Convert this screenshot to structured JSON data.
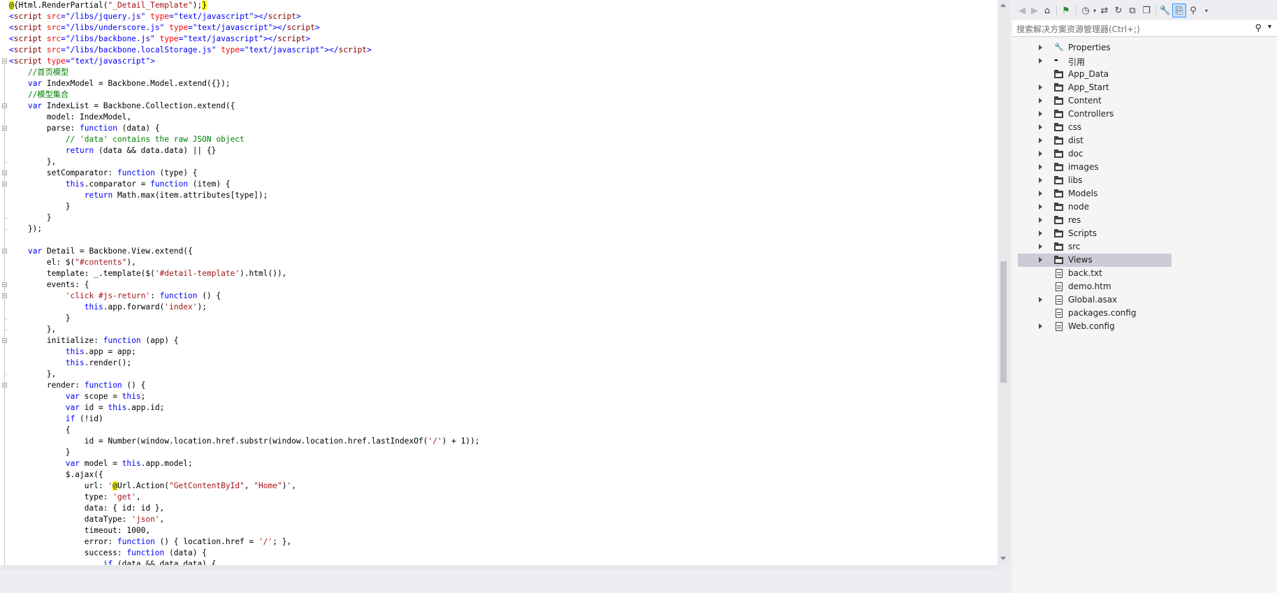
{
  "editor": {
    "lines": [
      [
        [
          "@",
          "r"
        ],
        [
          "{Html.RenderPartial(",
          ""
        ],
        [
          "\"_Detail_Template\"",
          "s"
        ],
        [
          ");",
          ""
        ],
        [
          "}",
          "r"
        ]
      ],
      [
        [
          "<",
          "k"
        ],
        [
          "script",
          "t"
        ],
        [
          " ",
          ""
        ],
        [
          "src",
          "a"
        ],
        [
          "=",
          "k"
        ],
        [
          "\"/libs/jquery.js\"",
          "k"
        ],
        [
          " ",
          ""
        ],
        [
          "type",
          "a"
        ],
        [
          "=",
          "k"
        ],
        [
          "\"text/javascript\"",
          "k"
        ],
        [
          "></",
          "k"
        ],
        [
          "script",
          "t"
        ],
        [
          ">",
          "k"
        ]
      ],
      [
        [
          "<",
          "k"
        ],
        [
          "script",
          "t"
        ],
        [
          " ",
          ""
        ],
        [
          "src",
          "a"
        ],
        [
          "=",
          "k"
        ],
        [
          "\"/libs/underscore.js\"",
          "k"
        ],
        [
          " ",
          ""
        ],
        [
          "type",
          "a"
        ],
        [
          "=",
          "k"
        ],
        [
          "\"text/javascript\"",
          "k"
        ],
        [
          "></",
          "k"
        ],
        [
          "script",
          "t"
        ],
        [
          ">",
          "k"
        ]
      ],
      [
        [
          "<",
          "k"
        ],
        [
          "script",
          "t"
        ],
        [
          " ",
          ""
        ],
        [
          "src",
          "a"
        ],
        [
          "=",
          "k"
        ],
        [
          "\"/libs/backbone.js\"",
          "k"
        ],
        [
          " ",
          ""
        ],
        [
          "type",
          "a"
        ],
        [
          "=",
          "k"
        ],
        [
          "\"text/javascript\"",
          "k"
        ],
        [
          "></",
          "k"
        ],
        [
          "script",
          "t"
        ],
        [
          ">",
          "k"
        ]
      ],
      [
        [
          "<",
          "k"
        ],
        [
          "script",
          "t"
        ],
        [
          " ",
          ""
        ],
        [
          "src",
          "a"
        ],
        [
          "=",
          "k"
        ],
        [
          "\"/libs/backbone.localStorage.js\"",
          "k"
        ],
        [
          " ",
          ""
        ],
        [
          "type",
          "a"
        ],
        [
          "=",
          "k"
        ],
        [
          "\"text/javascript\"",
          "k"
        ],
        [
          "></",
          "k"
        ],
        [
          "script",
          "t"
        ],
        [
          ">",
          "k"
        ]
      ],
      [
        [
          "<",
          "k"
        ],
        [
          "script",
          "t"
        ],
        [
          " ",
          ""
        ],
        [
          "type",
          "a"
        ],
        [
          "=",
          "k"
        ],
        [
          "\"text/javascript\"",
          "k"
        ],
        [
          ">",
          "k"
        ]
      ],
      [
        [
          "    //首页模型",
          "c"
        ]
      ],
      [
        [
          "    ",
          ""
        ],
        [
          "var",
          "k"
        ],
        [
          " IndexModel = Backbone.Model.extend({});",
          ""
        ]
      ],
      [
        [
          "    //模型集合",
          "c"
        ]
      ],
      [
        [
          "    ",
          ""
        ],
        [
          "var",
          "k"
        ],
        [
          " IndexList = Backbone.Collection.extend({",
          ""
        ]
      ],
      [
        [
          "        model: IndexModel,",
          ""
        ]
      ],
      [
        [
          "        parse: ",
          ""
        ],
        [
          "function",
          "k"
        ],
        [
          " (data) {",
          ""
        ]
      ],
      [
        [
          "            // 'data' contains the raw JSON object",
          "c"
        ]
      ],
      [
        [
          "            ",
          ""
        ],
        [
          "return",
          "k"
        ],
        [
          " (data && data.data) || {}",
          ""
        ]
      ],
      [
        [
          "        },",
          ""
        ]
      ],
      [
        [
          "        setComparator: ",
          ""
        ],
        [
          "function",
          "k"
        ],
        [
          " (type) {",
          ""
        ]
      ],
      [
        [
          "            ",
          ""
        ],
        [
          "this",
          "k"
        ],
        [
          ".comparator = ",
          ""
        ],
        [
          "function",
          "k"
        ],
        [
          " (item) {",
          ""
        ]
      ],
      [
        [
          "                ",
          ""
        ],
        [
          "return",
          "k"
        ],
        [
          " Math.max(item.attributes[type]);",
          ""
        ]
      ],
      [
        [
          "            }",
          ""
        ]
      ],
      [
        [
          "        }",
          ""
        ]
      ],
      [
        [
          "    });",
          ""
        ]
      ],
      [
        [
          "",
          ""
        ]
      ],
      [
        [
          "    ",
          ""
        ],
        [
          "var",
          "k"
        ],
        [
          " Detail = Backbone.View.extend({",
          ""
        ]
      ],
      [
        [
          "        el: $(",
          ""
        ],
        [
          "\"#contents\"",
          "s"
        ],
        [
          "),",
          ""
        ]
      ],
      [
        [
          "        template: _.template($(",
          ""
        ],
        [
          "'#detail-template'",
          "s"
        ],
        [
          ").html()),",
          ""
        ]
      ],
      [
        [
          "        events: {",
          ""
        ]
      ],
      [
        [
          "            ",
          ""
        ],
        [
          "'click #js-return'",
          "s"
        ],
        [
          ": ",
          ""
        ],
        [
          "function",
          "k"
        ],
        [
          " () {",
          ""
        ]
      ],
      [
        [
          "                ",
          ""
        ],
        [
          "this",
          "k"
        ],
        [
          ".app.forward(",
          ""
        ],
        [
          "'index'",
          "s"
        ],
        [
          ");",
          ""
        ]
      ],
      [
        [
          "            }",
          ""
        ]
      ],
      [
        [
          "        },",
          ""
        ]
      ],
      [
        [
          "        initialize: ",
          ""
        ],
        [
          "function",
          "k"
        ],
        [
          " (app) {",
          ""
        ]
      ],
      [
        [
          "            ",
          ""
        ],
        [
          "this",
          "k"
        ],
        [
          ".app = app;",
          ""
        ]
      ],
      [
        [
          "            ",
          ""
        ],
        [
          "this",
          "k"
        ],
        [
          ".render();",
          ""
        ]
      ],
      [
        [
          "        },",
          ""
        ]
      ],
      [
        [
          "        render: ",
          ""
        ],
        [
          "function",
          "k"
        ],
        [
          " () {",
          ""
        ]
      ],
      [
        [
          "            ",
          ""
        ],
        [
          "var",
          "k"
        ],
        [
          " scope = ",
          ""
        ],
        [
          "this",
          "k"
        ],
        [
          ";",
          ""
        ]
      ],
      [
        [
          "            ",
          ""
        ],
        [
          "var",
          "k"
        ],
        [
          " id = ",
          ""
        ],
        [
          "this",
          "k"
        ],
        [
          ".app.id;",
          ""
        ]
      ],
      [
        [
          "            ",
          ""
        ],
        [
          "if",
          "k"
        ],
        [
          " (!id)",
          ""
        ]
      ],
      [
        [
          "            {",
          ""
        ]
      ],
      [
        [
          "                id = Number(window.location.href.substr(window.location.href.lastIndexOf(",
          ""
        ],
        [
          "'/'",
          "s"
        ],
        [
          ") + 1));",
          ""
        ]
      ],
      [
        [
          "            }",
          ""
        ]
      ],
      [
        [
          "            ",
          ""
        ],
        [
          "var",
          "k"
        ],
        [
          " model = ",
          ""
        ],
        [
          "this",
          "k"
        ],
        [
          ".app.model;",
          ""
        ]
      ],
      [
        [
          "            $.ajax({",
          ""
        ]
      ],
      [
        [
          "                url: ",
          ""
        ],
        [
          "'",
          "s"
        ],
        [
          "@",
          "r"
        ],
        [
          "Url.Action(",
          ""
        ],
        [
          "\"GetContentById\"",
          "s"
        ],
        [
          ", ",
          ""
        ],
        [
          "\"Home\"",
          "s"
        ],
        [
          ")",
          ""
        ],
        [
          "'",
          "s"
        ],
        [
          ",",
          ""
        ]
      ],
      [
        [
          "                type: ",
          ""
        ],
        [
          "'get'",
          "s"
        ],
        [
          ",",
          ""
        ]
      ],
      [
        [
          "                data: { id: id },",
          ""
        ]
      ],
      [
        [
          "                dataType: ",
          ""
        ],
        [
          "'json'",
          "s"
        ],
        [
          ",",
          ""
        ]
      ],
      [
        [
          "                timeout: 1000,",
          ""
        ]
      ],
      [
        [
          "                error: ",
          ""
        ],
        [
          "function",
          "k"
        ],
        [
          " () { location.href = ",
          ""
        ],
        [
          "'/'",
          "s"
        ],
        [
          "; },",
          ""
        ]
      ],
      [
        [
          "                success: ",
          ""
        ],
        [
          "function",
          "k"
        ],
        [
          " (data) {",
          ""
        ]
      ],
      [
        [
          "                    ",
          ""
        ],
        [
          "if",
          "k"
        ],
        [
          " (data && data.data) {",
          ""
        ]
      ]
    ]
  },
  "explorer": {
    "search_placeholder": "搜索解决方案资源管理器(Ctrl+;)",
    "items": [
      {
        "label": "Properties",
        "icon": "wrench-icon",
        "expandable": true
      },
      {
        "label": "引用",
        "icon": "references-icon",
        "expandable": true
      },
      {
        "label": "App_Data",
        "icon": "folder-icon",
        "expandable": false
      },
      {
        "label": "App_Start",
        "icon": "folder-icon",
        "expandable": true
      },
      {
        "label": "Content",
        "icon": "folder-icon",
        "expandable": true
      },
      {
        "label": "Controllers",
        "icon": "folder-icon",
        "expandable": true
      },
      {
        "label": "css",
        "icon": "folder-icon",
        "expandable": true
      },
      {
        "label": "dist",
        "icon": "folder-icon",
        "expandable": true
      },
      {
        "label": "doc",
        "icon": "folder-icon",
        "expandable": true
      },
      {
        "label": "images",
        "icon": "folder-icon",
        "expandable": true
      },
      {
        "label": "libs",
        "icon": "folder-icon",
        "expandable": true
      },
      {
        "label": "Models",
        "icon": "folder-icon",
        "expandable": true
      },
      {
        "label": "node",
        "icon": "folder-icon",
        "expandable": true
      },
      {
        "label": "res",
        "icon": "folder-icon",
        "expandable": true
      },
      {
        "label": "Scripts",
        "icon": "folder-icon",
        "expandable": true
      },
      {
        "label": "src",
        "icon": "folder-icon",
        "expandable": true
      },
      {
        "label": "Views",
        "icon": "folder-icon",
        "expandable": true,
        "selected": true
      },
      {
        "label": "back.txt",
        "icon": "file-icon",
        "expandable": false
      },
      {
        "label": "demo.htm",
        "icon": "html-file-icon",
        "expandable": false
      },
      {
        "label": "Global.asax",
        "icon": "asax-file-icon",
        "expandable": true
      },
      {
        "label": "packages.config",
        "icon": "config-file-icon",
        "expandable": false
      },
      {
        "label": "Web.config",
        "icon": "config-file-icon",
        "expandable": true
      }
    ]
  },
  "colors": {
    "keyword": "#0000ff",
    "string": "#a31515",
    "comment": "#008000",
    "tag": "#800000",
    "attribute": "#ff0000",
    "razor_highlight": "#ffff00",
    "selection": "#ccccd6"
  }
}
